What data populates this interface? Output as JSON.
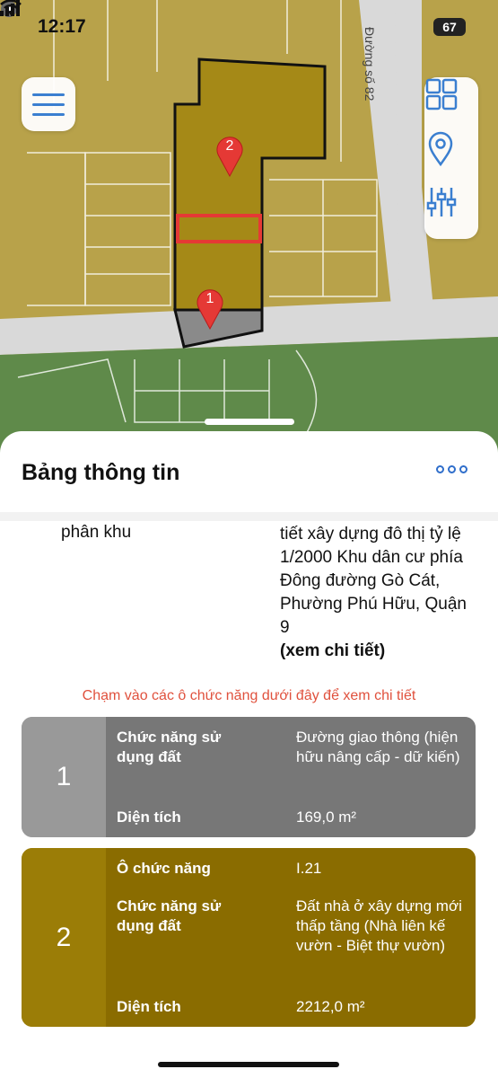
{
  "status_bar": {
    "time": "12:17",
    "battery": "67"
  },
  "map": {
    "road_label": "Đường số 82",
    "pins": [
      "2",
      "1"
    ],
    "colors": {
      "land": "#b8a24a",
      "green": "#5f8a4a",
      "road": "#d9d9d9",
      "selection": "#e53935"
    }
  },
  "sheet": {
    "title": "Bảng thông tin",
    "partial_label": "phân khu",
    "partial_value": "tiết xây dựng đô thị tỷ lệ 1/2000  Khu dân cư phía Đông đường Gò Cát, Phường Phú Hữu, Quận 9",
    "detail_link": "(xem chi tiết)",
    "hint": "Chạm vào các ô chức năng dưới đây để xem chi tiết",
    "cards": [
      {
        "number": "1",
        "rows": [
          {
            "label": "Chức năng sử dụng đất",
            "value": "Đường giao thông (hiện hữu nâng cấp - dữ kiến)"
          },
          {
            "label": "Diện tích",
            "value": "169,0 m²"
          }
        ]
      },
      {
        "number": "2",
        "rows": [
          {
            "label": "Ô chức năng",
            "value": "I.21"
          },
          {
            "label": "Chức năng sử dụng đất",
            "value": "Đất nhà ở xây dựng mới thấp tầng (Nhà liên kế vườn - Biệt thự vườn)"
          },
          {
            "label": "Diện tích",
            "value": "2212,0 m²"
          }
        ]
      }
    ]
  }
}
